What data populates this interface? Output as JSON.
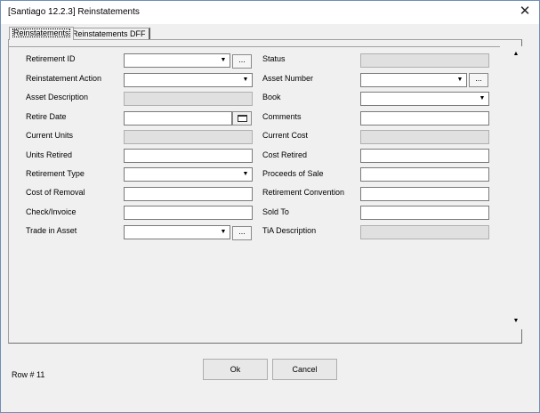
{
  "window": {
    "title": "[Santiago 12.2.3] Reinstatements",
    "close_glyph": "✕"
  },
  "tabs": [
    {
      "label": "Reinstatements",
      "active": true
    },
    {
      "label": "Reinstatements DFF",
      "active": false
    }
  ],
  "form": {
    "left": {
      "retirement_id": {
        "label": "Retirement ID",
        "value": "",
        "lookup_label": "..."
      },
      "reinstatement_action": {
        "label": "Reinstatement Action",
        "value": ""
      },
      "asset_description": {
        "label": "Asset Description",
        "value": ""
      },
      "retire_date": {
        "label": "Retire Date",
        "value": ""
      },
      "current_units": {
        "label": "Current Units",
        "value": ""
      },
      "units_retired": {
        "label": "Units Retired",
        "value": ""
      },
      "retirement_type": {
        "label": "Retirement Type",
        "value": ""
      },
      "cost_of_removal": {
        "label": "Cost of Removal",
        "value": ""
      },
      "check_invoice": {
        "label": "Check/Invoice",
        "value": ""
      },
      "trade_in_asset": {
        "label": "Trade in Asset",
        "value": "",
        "lookup_label": "..."
      }
    },
    "right": {
      "status": {
        "label": "Status",
        "value": ""
      },
      "asset_number": {
        "label": "Asset Number",
        "value": "",
        "lookup_label": "..."
      },
      "book": {
        "label": "Book",
        "value": ""
      },
      "comments": {
        "label": "Comments",
        "value": ""
      },
      "current_cost": {
        "label": "Current Cost",
        "value": ""
      },
      "cost_retired": {
        "label": "Cost Retired",
        "value": ""
      },
      "proceeds_of_sale": {
        "label": "Proceeds of Sale",
        "value": ""
      },
      "retirement_convention": {
        "label": "Retirement Convention",
        "value": ""
      },
      "sold_to": {
        "label": "Sold To",
        "value": ""
      },
      "tia_description": {
        "label": "TiA Description",
        "value": ""
      }
    }
  },
  "icons": {
    "dropdown": "▼",
    "scroll_up": "▲",
    "scroll_down": "▼",
    "calendar": "calendar-icon"
  },
  "footer": {
    "row_status": "Row # 11",
    "ok_label": "Ok",
    "cancel_label": "Cancel"
  }
}
